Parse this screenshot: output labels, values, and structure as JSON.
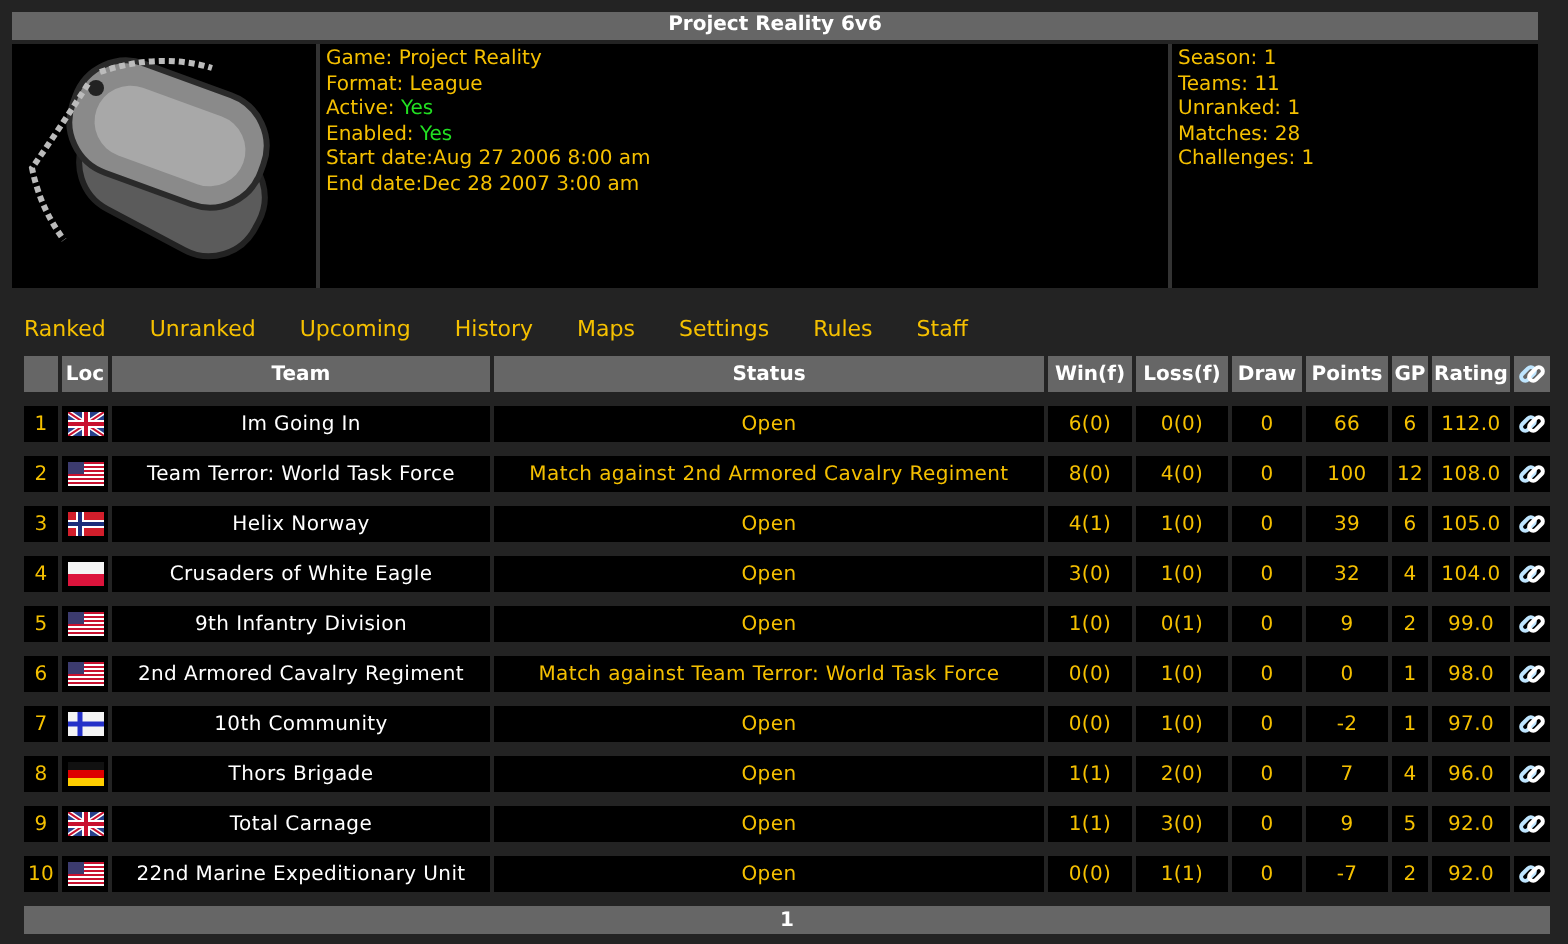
{
  "title": "Project Reality 6v6",
  "details": [
    {
      "label": "Game: ",
      "value": "Project Reality",
      "positive": false
    },
    {
      "label": "Format: ",
      "value": "League",
      "positive": false
    },
    {
      "label": "Active: ",
      "value": "Yes",
      "positive": true
    },
    {
      "label": "Enabled: ",
      "value": "Yes",
      "positive": true
    },
    {
      "label": "Start date:",
      "value": "Aug 27 2006 8:00 am",
      "positive": false
    },
    {
      "label": "End date:",
      "value": "Dec 28 2007 3:00 am",
      "positive": false
    }
  ],
  "stats": [
    "Season: 1",
    "Teams: 11",
    "Unranked: 1",
    "Matches: 28",
    "Challenges: 1"
  ],
  "nav": [
    "Ranked",
    "Unranked",
    "Upcoming",
    "History",
    "Maps",
    "Settings",
    "Rules",
    "Staff"
  ],
  "columns": [
    "Loc",
    "Team",
    "Status",
    "Win(f)",
    "Loss(f)",
    "Draw",
    "Points",
    "GP",
    "Rating"
  ],
  "rows": [
    {
      "rank": "1",
      "loc": {
        "kind": "uk"
      },
      "team": "Im Going In",
      "status": "Open",
      "win": "6(0)",
      "loss": "0(0)",
      "draw": "0",
      "points": "66",
      "gp": "6",
      "rating": "112.0"
    },
    {
      "rank": "2",
      "loc": {
        "kind": "us"
      },
      "team": "Team Terror: World Task Force",
      "status": "Match against 2nd Armored Cavalry Regiment",
      "win": "8(0)",
      "loss": "4(0)",
      "draw": "0",
      "points": "100",
      "gp": "12",
      "rating": "108.0"
    },
    {
      "rank": "3",
      "loc": {
        "kind": "no"
      },
      "team": "Helix Norway",
      "status": "Open",
      "win": "4(1)",
      "loss": "1(0)",
      "draw": "0",
      "points": "39",
      "gp": "6",
      "rating": "105.0"
    },
    {
      "rank": "4",
      "loc": {
        "kind": "pl"
      },
      "team": "Crusaders of White Eagle",
      "status": "Open",
      "win": "3(0)",
      "loss": "1(0)",
      "draw": "0",
      "points": "32",
      "gp": "4",
      "rating": "104.0"
    },
    {
      "rank": "5",
      "loc": {
        "kind": "us"
      },
      "team": "9th Infantry Division",
      "status": "Open",
      "win": "1(0)",
      "loss": "0(1)",
      "draw": "0",
      "points": "9",
      "gp": "2",
      "rating": "99.0"
    },
    {
      "rank": "6",
      "loc": {
        "kind": "us"
      },
      "team": "2nd Armored Cavalry Regiment",
      "status": "Match against Team Terror: World Task Force",
      "win": "0(0)",
      "loss": "1(0)",
      "draw": "0",
      "points": "0",
      "gp": "1",
      "rating": "98.0"
    },
    {
      "rank": "7",
      "loc": {
        "kind": "fi"
      },
      "team": "10th Community",
      "status": "Open",
      "win": "0(0)",
      "loss": "1(0)",
      "draw": "0",
      "points": "-2",
      "gp": "1",
      "rating": "97.0"
    },
    {
      "rank": "8",
      "loc": {
        "kind": "de"
      },
      "team": "Thors Brigade",
      "status": "Open",
      "win": "1(1)",
      "loss": "2(0)",
      "draw": "0",
      "points": "7",
      "gp": "4",
      "rating": "96.0"
    },
    {
      "rank": "9",
      "loc": {
        "kind": "uk"
      },
      "team": "Total Carnage",
      "status": "Open",
      "win": "1(1)",
      "loss": "3(0)",
      "draw": "0",
      "points": "9",
      "gp": "5",
      "rating": "92.0"
    },
    {
      "rank": "10",
      "loc": {
        "kind": "us"
      },
      "team": "22nd Marine Expeditionary Unit",
      "status": "Open",
      "win": "0(0)",
      "loss": "1(1)",
      "draw": "0",
      "points": "-7",
      "gp": "2",
      "rating": "92.0"
    }
  ],
  "pages": [
    "1"
  ]
}
